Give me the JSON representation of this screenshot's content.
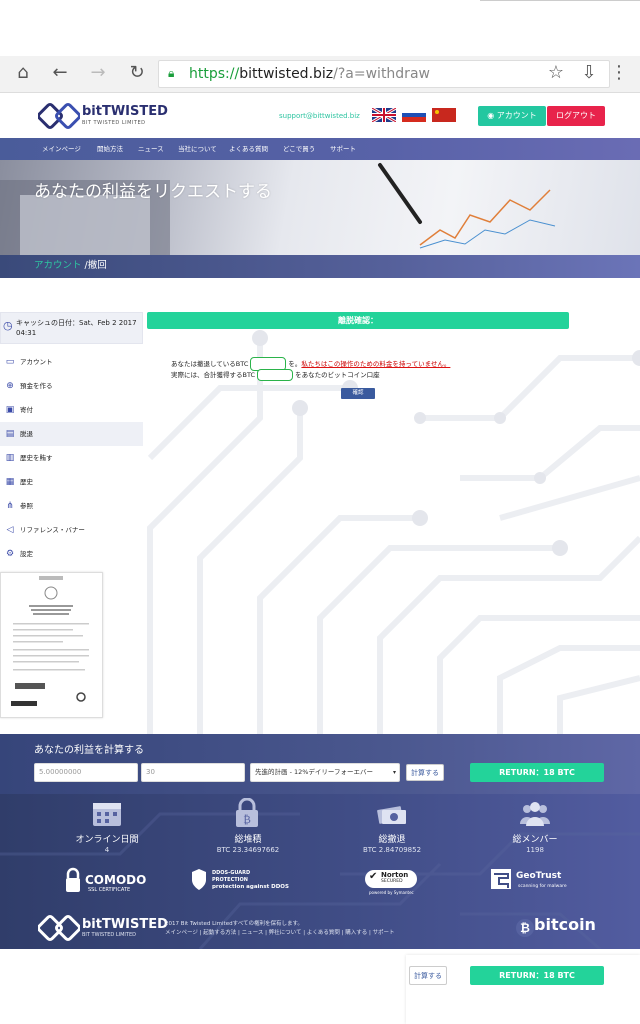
{
  "browser": {
    "url_scheme": "https://",
    "url_host": "bittwisted.biz",
    "url_path": "/?a=withdraw"
  },
  "header": {
    "logo_name": "bitTWISTED",
    "logo_sub": "BIT TWISTED LIMITED",
    "support_email": "support@bittwisted.biz",
    "account_btn": "アカウント",
    "logout_btn": "ログアウト"
  },
  "nav": [
    "メインページ",
    "開始方法",
    "ニュース",
    "当社について",
    "よくある質問",
    "どこで買う",
    "サポート"
  ],
  "hero": {
    "title": "あなたの利益をリクエストする",
    "crumb_link": "アカウント",
    "crumb_sep": " /",
    "crumb_current": "撤回"
  },
  "sidebar": {
    "date_label": "キャッシュの日付：Sat、Feb 2 2017 04:31",
    "items": [
      {
        "label": "アカウント",
        "icon": "account-icon"
      },
      {
        "label": "預金を作る",
        "icon": "plus-circle-icon"
      },
      {
        "label": "寄付",
        "icon": "gift-icon"
      },
      {
        "label": "脱退",
        "icon": "withdraw-icon"
      },
      {
        "label": "歴史を賄す",
        "icon": "history-deposit-icon"
      },
      {
        "label": "歴史",
        "icon": "history-icon"
      },
      {
        "label": "参照",
        "icon": "referral-icon"
      },
      {
        "label": "リファレンス・バナー",
        "icon": "megaphone-icon"
      },
      {
        "label": "設定",
        "icon": "gear-icon"
      }
    ],
    "active_index": 3
  },
  "main": {
    "section_title": "離脱確認：",
    "line1_a": "あなたは撤退しているBTC",
    "line1_b": "を。",
    "line1_c": "私たちはこの操作のための料金を持っていません。",
    "line2_a": "実際には、合計獲得するBTC",
    "line2_b": "をあなたのビットコイン口座",
    "confirm_button": "確認"
  },
  "calculator": {
    "title": "あなたの利益を計算する",
    "amount": "5.00000000",
    "days": "30",
    "plan": "先進的計画 - 12%デイリーフォーエバー",
    "calc_button": "計算する",
    "return_text": "RETURN：18 BTC"
  },
  "stats": [
    {
      "label": "オンライン日間",
      "value": "4",
      "icon": "calendar-icon"
    },
    {
      "label": "総堆積",
      "value": "BTC 23.34697662",
      "icon": "bitcoin-lock-icon"
    },
    {
      "label": "総撤退",
      "value": "BTC 2.84709852",
      "icon": "cash-icon"
    },
    {
      "label": "総メンバー",
      "value": "1198",
      "icon": "members-icon"
    }
  ],
  "badges": {
    "comodo": "COMODO",
    "comodo_sub": "SSL CERTIFICATE",
    "ddos": "DDOS-GUARD",
    "ddos_sub": "PROTECTION",
    "ddos_sub2": "protection against DDOS",
    "norton": "Norton",
    "norton_sub": "SECURED",
    "norton_sub2": "powered by Symantec",
    "geotrust": "GeoTrust",
    "geotrust_sub": "scanning for malware"
  },
  "footer": {
    "copyright": "2017 Bit Twisted Limitedすべての権利を保有します。",
    "links": "メインページ | 起動する方法 | ニュース | 弊社について | よくある質問 | 購入する | サポート",
    "bitcoin": "bitcoin"
  },
  "colors": {
    "accent": "#23d39a",
    "brand": "#2a2f70",
    "logout": "#e8234b",
    "nav": "#5862a8"
  }
}
